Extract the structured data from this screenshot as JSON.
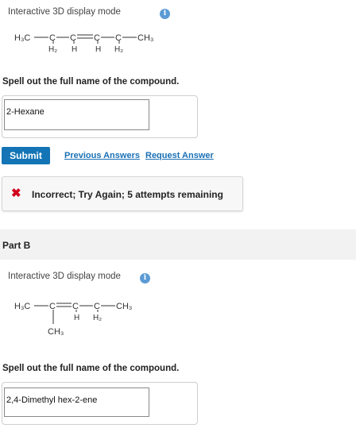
{
  "part_a": {
    "display_mode_label": "Interactive 3D display mode",
    "info_icon": "info-icon",
    "structure_labels": {
      "h3c": "H₃C",
      "c1": "C",
      "c2": "C",
      "c3": "C",
      "c4": "C",
      "ch3": "CH₃",
      "h2_1": "H₂",
      "h_1": "H",
      "h_2": "H",
      "h2_2": "H₂"
    },
    "question": "Spell out the full name of the compound.",
    "answer_value": "2-Hexane",
    "submit_label": "Submit",
    "previous_answers_label": "Previous Answers",
    "request_answer_label": "Request Answer",
    "feedback_icon": "x-icon",
    "feedback_text": "Incorrect; Try Again; 5 attempts remaining"
  },
  "part_b": {
    "title": "Part B",
    "display_mode_label": "Interactive 3D display mode",
    "info_icon": "info-icon",
    "structure_labels": {
      "h3c": "H₃C",
      "c1": "C",
      "c2": "C",
      "c3": "C",
      "ch3": "CH₃",
      "h": "H",
      "h2": "H₂",
      "branch_ch3": "CH₃"
    },
    "question": "Spell out the full name of the compound.",
    "answer_value": "2,4-Dimethyl hex-2-ene"
  },
  "colors": {
    "submit": "#1475b6",
    "link": "#1a70b5",
    "error": "#d0021b",
    "info": "#5b9bd5"
  }
}
